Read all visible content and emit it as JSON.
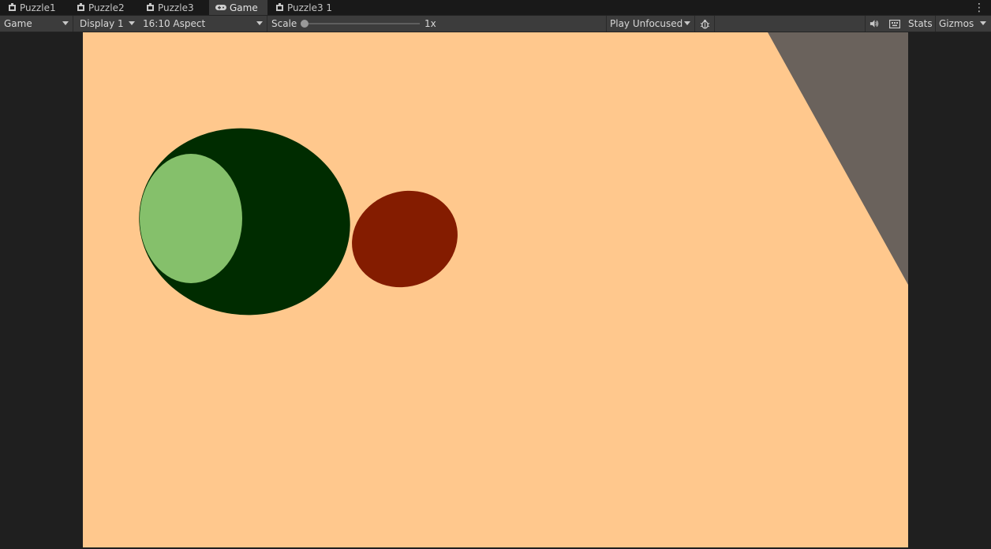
{
  "tabs": [
    {
      "label": "Puzzle1",
      "icon": "scene-icon",
      "active": false
    },
    {
      "label": "Puzzle2",
      "icon": "scene-icon",
      "active": false
    },
    {
      "label": "Puzzle3",
      "icon": "scene-icon",
      "active": false
    },
    {
      "label": "Game",
      "icon": "gamepad-icon",
      "active": true
    },
    {
      "label": "Puzzle3 1",
      "icon": "scene-icon",
      "active": false
    }
  ],
  "toolbar": {
    "view_mode": "Game",
    "display": "Display 1",
    "aspect": "16:10 Aspect",
    "scale_label": "Scale",
    "scale_value": "1x",
    "scale_fraction": 0.0,
    "play_mode": "Play Unfocused",
    "stats_label": "Stats",
    "gizmos_label": "Gizmos"
  },
  "game": {
    "background_color": "#ffc88d",
    "large_circle_color": "#002c00",
    "inner_circle_color": "#85c06b",
    "small_ellipse_color": "#841c00",
    "corner_shape_color": "#6a625c"
  }
}
